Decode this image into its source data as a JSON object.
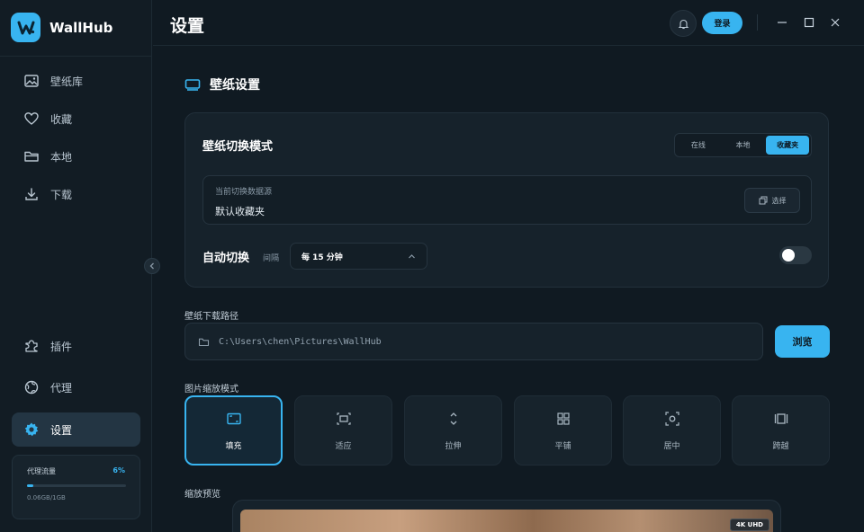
{
  "app": {
    "name": "WallHub"
  },
  "sidebar": {
    "items": [
      {
        "label": "壁纸库",
        "icon": "image-icon"
      },
      {
        "label": "收藏",
        "icon": "heart-icon"
      },
      {
        "label": "本地",
        "icon": "folder-icon"
      },
      {
        "label": "下载",
        "icon": "download-icon"
      }
    ],
    "bottom_items": [
      {
        "label": "插件",
        "icon": "puzzle-icon"
      },
      {
        "label": "代理",
        "icon": "globe-icon"
      },
      {
        "label": "设置",
        "icon": "gear-icon",
        "active": true
      }
    ],
    "traffic": {
      "label": "代理流量",
      "percent_text": "6%",
      "percent": 6,
      "amount": "0.06GB/1GB"
    }
  },
  "header": {
    "title": "设置",
    "login_label": "登录"
  },
  "settings": {
    "section_title": "壁纸设置",
    "switch_mode": {
      "label": "壁纸切换模式",
      "options": [
        "在线",
        "本地",
        "收藏夹"
      ],
      "selected": "收藏夹"
    },
    "source": {
      "caption": "当前切换数据源",
      "value": "默认收藏夹",
      "select_label": "选择"
    },
    "auto_switch": {
      "label": "自动切换",
      "interval_label": "间隔",
      "interval_value": "每 15 分钟",
      "enabled": false
    },
    "download_path": {
      "label": "壁纸下载路径",
      "value": "C:\\Users\\chen\\Pictures\\WallHub",
      "browse_label": "浏览"
    },
    "scale_mode": {
      "label": "图片缩放模式",
      "options": [
        {
          "label": "填充",
          "icon": "fill-icon",
          "active": true
        },
        {
          "label": "适应",
          "icon": "fit-icon"
        },
        {
          "label": "拉伸",
          "icon": "stretch-icon"
        },
        {
          "label": "平铺",
          "icon": "tile-icon"
        },
        {
          "label": "居中",
          "icon": "center-icon"
        },
        {
          "label": "跨越",
          "icon": "span-icon"
        }
      ]
    },
    "preview": {
      "label": "缩放预览",
      "badge": "4K UHD"
    }
  },
  "colors": {
    "accent": "#38b4f0",
    "background": "#101a22",
    "sidebar": "#121c24",
    "card": "#16222b"
  }
}
